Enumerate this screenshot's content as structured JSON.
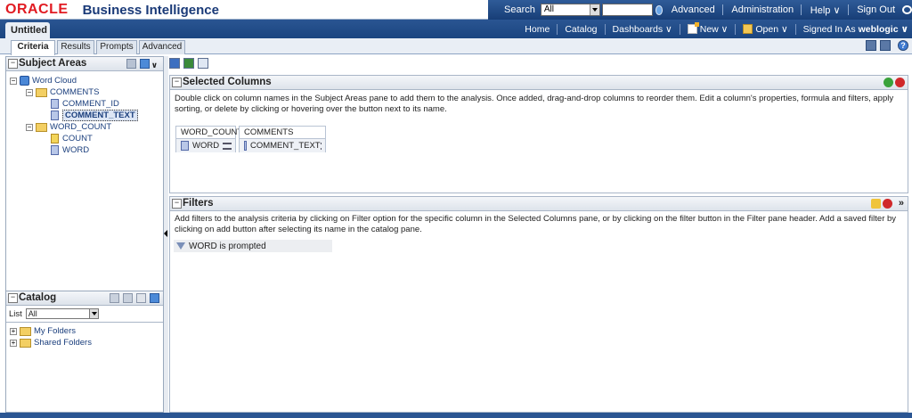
{
  "top": {
    "brand": "ORACLE",
    "product": "Business Intelligence",
    "search_label": "Search",
    "search_scope": "All",
    "search_placeholder": "",
    "links": [
      "Advanced",
      "Administration",
      "Help ∨",
      "Sign Out"
    ]
  },
  "nav": {
    "doc_tab": "Untitled",
    "home": "Home",
    "catalog": "Catalog",
    "dashboards": "Dashboards ∨",
    "new": "New ∨",
    "open": "Open ∨",
    "signed_in_as": "Signed In As",
    "user": "weblogic ∨"
  },
  "tabs": [
    "Criteria",
    "Results",
    "Prompts",
    "Advanced"
  ],
  "subject_areas": {
    "title": "Subject Areas",
    "tree": [
      {
        "label": "Word Cloud",
        "kind": "cube-icon"
      },
      {
        "label": "COMMENTS",
        "kind": "folder-icon"
      },
      {
        "label": "COMMENT_ID",
        "kind": "column-icon"
      },
      {
        "label": "COMMENT_TEXT",
        "kind": "column-icon",
        "selected": true
      },
      {
        "label": "WORD_COUNT",
        "kind": "folder-icon"
      },
      {
        "label": "COUNT",
        "kind": "measure-icon"
      },
      {
        "label": "WORD",
        "kind": "column-icon"
      }
    ]
  },
  "catalog": {
    "title": "Catalog",
    "list_label": "List",
    "list_value": "All",
    "folders": [
      "My Folders",
      "Shared Folders"
    ]
  },
  "selected_columns": {
    "title": "Selected Columns",
    "description": "Double click on column names in the Subject Areas pane to add them to the analysis. Once added, drag-and-drop columns to reorder them. Edit a column's properties, formula and filters, apply sorting, or delete by clicking or hovering over the button next to its name.",
    "columns": [
      {
        "folder": "WORD_COUNT",
        "name": "WORD"
      },
      {
        "folder": "COMMENTS",
        "name": "COMMENT_TEXT"
      }
    ]
  },
  "filters": {
    "title": "Filters",
    "more": "»",
    "description": "Add filters to the analysis criteria by clicking on Filter option for the specific column in the Selected Columns pane, or by clicking on the filter button in the Filter pane header. Add a saved filter by clicking on add button after selecting its name in the catalog pane.",
    "items": [
      "WORD is prompted"
    ]
  },
  "colors": {
    "brand_red": "#e11b22",
    "brand_blue": "#1a3a78",
    "bar_blue": "#1b4580"
  }
}
